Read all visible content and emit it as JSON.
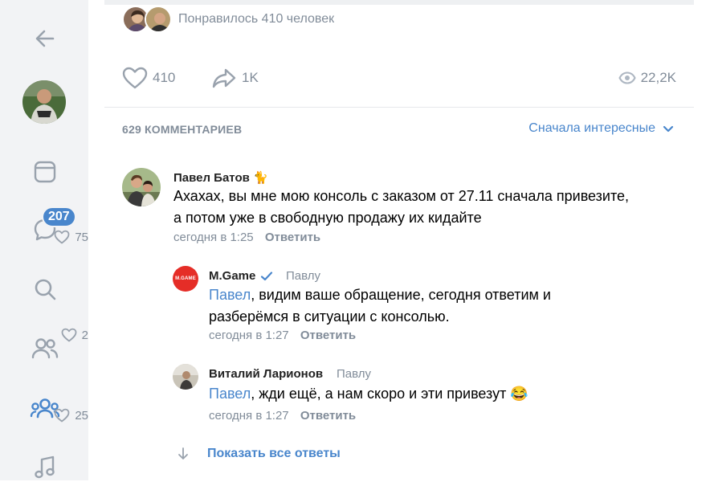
{
  "sidebar": {
    "messages_badge": "207"
  },
  "post": {
    "liked_text": "Понравилось 410 человек",
    "likes": "410",
    "shares": "1K",
    "views": "22,2K"
  },
  "comments_header": {
    "count": "629 КОММЕНТАРИЕВ",
    "sort": "Сначала интересные"
  },
  "comments": [
    {
      "author": "Павел Батов",
      "author_emoji": "🐈",
      "text_line1": "Ахахах, вы мне мою консоль с заказом от 27.11 сначала привезите,",
      "text_line2": "а потом уже в свободную продажу их кидайте",
      "time": "сегодня в 1:25",
      "reply_label": "Ответить",
      "likes": "75"
    }
  ],
  "replies": [
    {
      "author": "M.Game",
      "reply_to": "Павлу",
      "avatar_text": "M.GAME",
      "mention": "Павел",
      "text_line1_rest": ", видим ваше обращение, сегодня ответим и",
      "text_line2": "разберёмся в ситуации с консолью.",
      "time": "сегодня в 1:27",
      "reply_label": "Ответить",
      "likes": "2"
    },
    {
      "author": "Виталий Ларионов",
      "reply_to": "Павлу",
      "mention": "Павел",
      "text_line1_rest": ", жди ещё, а нам скоро и эти привезут",
      "emoji": "😂",
      "time": "сегодня в 1:27",
      "reply_label": "Ответить",
      "likes": "25"
    }
  ],
  "show_all_replies": "Показать все ответы",
  "colors": {
    "accent": "#4986cc",
    "secondary_text": "#818c99",
    "mgame_red": "#e52d27",
    "verified": "#4986cc"
  }
}
